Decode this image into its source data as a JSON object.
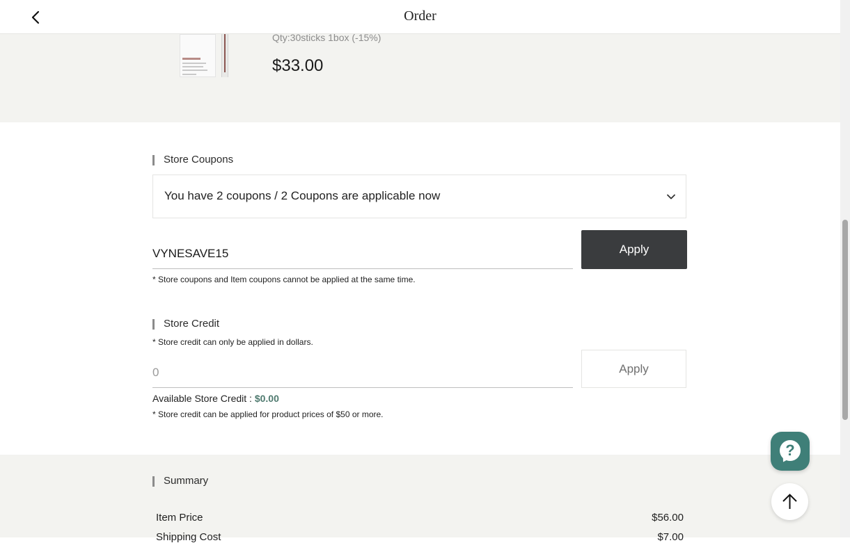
{
  "header": {
    "title": "Order"
  },
  "product": {
    "qty_text": "Qty:30sticks 1box (-15%)",
    "price": "$33.00"
  },
  "coupons": {
    "section_label": "Store Coupons",
    "select_text": "You have 2 coupons / 2 Coupons are applicable now",
    "code_value": "VYNESAVE15",
    "apply_label": "Apply",
    "note": "* Store coupons and Item coupons cannot be applied at the same time."
  },
  "credit": {
    "section_label": "Store Credit",
    "note_top": "* Store credit can only be applied in dollars.",
    "input_placeholder": "0",
    "apply_label": "Apply",
    "available_label": "Available Store Credit : ",
    "available_amount": "$0.00",
    "note_bottom": "* Store credit can be applied for product prices of $50 or more."
  },
  "summary": {
    "section_label": "Summary",
    "rows": [
      {
        "label": "Item Price",
        "value": "$56.00"
      },
      {
        "label": "Shipping Cost",
        "value": "$7.00"
      }
    ]
  },
  "colors": {
    "accent_green": "#3f7f78",
    "dark_button": "#3a3c3e",
    "section_bg": "#f3f3f0"
  }
}
